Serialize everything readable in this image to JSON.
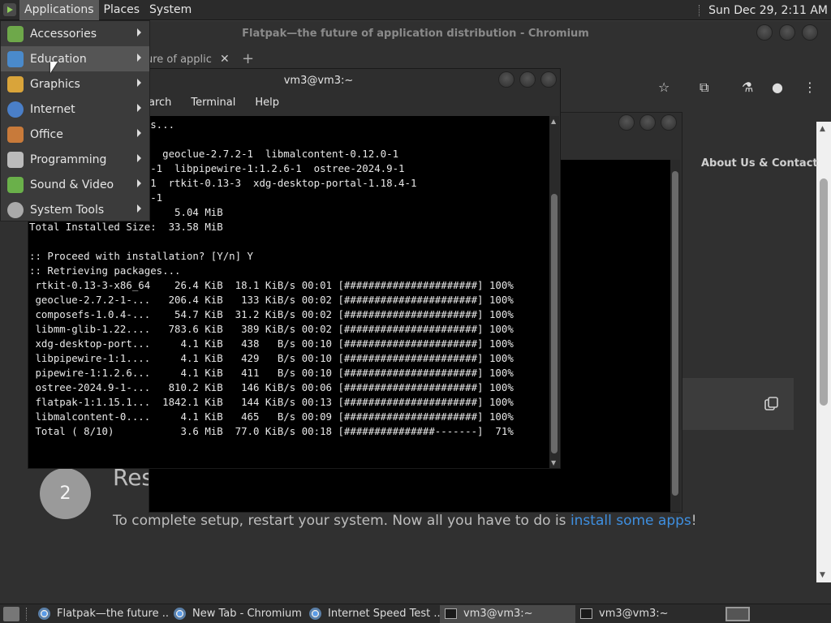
{
  "top_panel": {
    "menus": [
      "Applications",
      "Places",
      "System"
    ],
    "clock": "Sun Dec 29,  2:11 AM"
  },
  "apps_menu": {
    "items": [
      {
        "label": "Accessories",
        "icon": "accessories-icon",
        "color": "#6ea84a"
      },
      {
        "label": "Education",
        "icon": "education-icon",
        "color": "#4a8acb"
      },
      {
        "label": "Graphics",
        "icon": "graphics-icon",
        "color": "#d9a43a"
      },
      {
        "label": "Internet",
        "icon": "internet-icon",
        "color": "#4a7fc8"
      },
      {
        "label": "Office",
        "icon": "office-icon",
        "color": "#c87a3a"
      },
      {
        "label": "Programming",
        "icon": "programming-icon",
        "color": "#bbbbbb"
      },
      {
        "label": "Sound & Video",
        "icon": "sound-video-icon",
        "color": "#6ab04a"
      },
      {
        "label": "System Tools",
        "icon": "system-tools-icon",
        "color": "#aaaaaa"
      }
    ]
  },
  "chromium": {
    "title": "Flatpak—the future of application distribution - Chromium",
    "tab_label": "ure of applic",
    "nav_link": "About Us & Contact",
    "step_number": "2",
    "step_heading": "Res",
    "step_text_before": "To complete setup, restart your system. Now all you have to do is ",
    "step_text_link": "install some apps",
    "step_text_after": "!"
  },
  "terminal_front": {
    "title": "vm3@vm3:~",
    "menus": [
      "earch",
      "Terminal",
      "Help"
    ],
    "lines": [
      "       rting packages...",
      "",
      "       osefs-1.0.4-1  geoclue-2.7.2-1  libmalcontent-0.12.0-1",
      "       m-glib-1.22.0-1  libpipewire-1:1.2.6-1  ostree-2024.9-1",
      "       wire-1:1.2.6-1  rtkit-0.13-3  xdg-desktop-portal-1.18.4-1",
      "       pak-1:1.15.10-1",
      "Total Download Size:    5.04 MiB",
      "Total Installed Size:  33.58 MiB",
      "",
      ":: Proceed with installation? [Y/n] Y",
      ":: Retrieving packages...",
      " rtkit-0.13-3-x86_64    26.4 KiB  18.1 KiB/s 00:01 [######################] 100%",
      " geoclue-2.7.2-1-...   206.4 KiB   133 KiB/s 00:02 [######################] 100%",
      " composefs-1.0.4-...    54.7 KiB  31.2 KiB/s 00:02 [######################] 100%",
      " libmm-glib-1.22....   783.6 KiB   389 KiB/s 00:02 [######################] 100%",
      " xdg-desktop-port...     4.1 KiB   438   B/s 00:10 [######################] 100%",
      " libpipewire-1:1....     4.1 KiB   429   B/s 00:10 [######################] 100%",
      " pipewire-1:1.2.6...     4.1 KiB   411   B/s 00:10 [######################] 100%",
      " ostree-2024.9-1-...   810.2 KiB   146 KiB/s 00:06 [######################] 100%",
      " flatpak-1:1.15.1...  1842.1 KiB   144 KiB/s 00:13 [######################] 100%",
      " libmalcontent-0....     4.1 KiB   465   B/s 00:09 [######################] 100%",
      " Total ( 8/10)           3.6 MiB  77.0 KiB/s 00:18 [###############-------]  71%"
    ]
  },
  "taskbar": {
    "tasks": [
      {
        "label": "Flatpak—the future ...",
        "icon": "chromium-icon"
      },
      {
        "label": "New Tab - Chromium",
        "icon": "chromium-icon"
      },
      {
        "label": "Internet Speed Test ...",
        "icon": "chromium-icon"
      },
      {
        "label": "vm3@vm3:~",
        "icon": "terminal-icon",
        "active": true
      },
      {
        "label": "vm3@vm3:~",
        "icon": "terminal-icon"
      }
    ]
  }
}
